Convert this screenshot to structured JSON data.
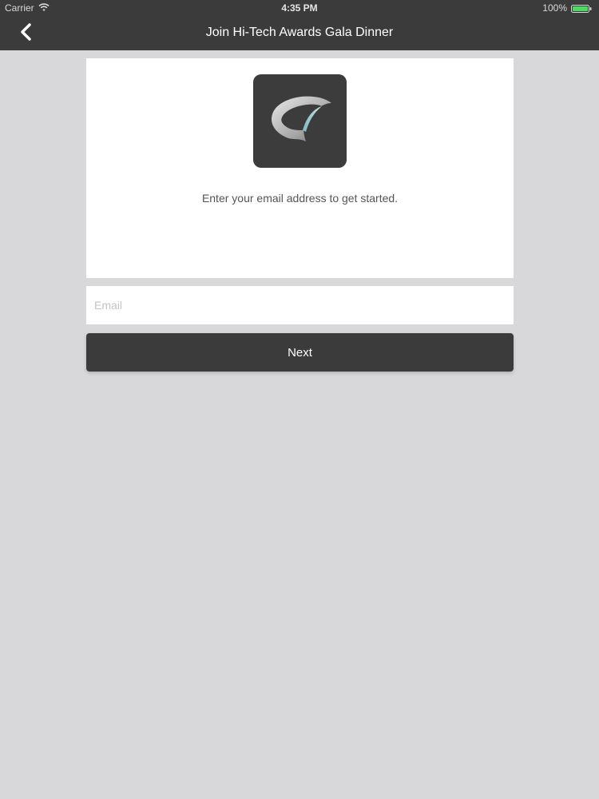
{
  "status_bar": {
    "carrier": "Carrier",
    "time": "4:35 PM",
    "battery": "100%",
    "wifi_icon": "wifi-icon",
    "battery_icon": "battery-icon",
    "battery_color": "#4cd964"
  },
  "nav": {
    "back_icon": "chevron-left-icon",
    "title": "Join Hi-Tech Awards Gala Dinner"
  },
  "card": {
    "logo_icon": "app-logo",
    "intro_text": "Enter your email address to get started."
  },
  "form": {
    "email_value": "",
    "email_placeholder": "Email",
    "next_label": "Next"
  },
  "colors": {
    "nav_bar": "#3b3b3c",
    "background": "#d8d8da",
    "button": "#3b3b3c"
  }
}
